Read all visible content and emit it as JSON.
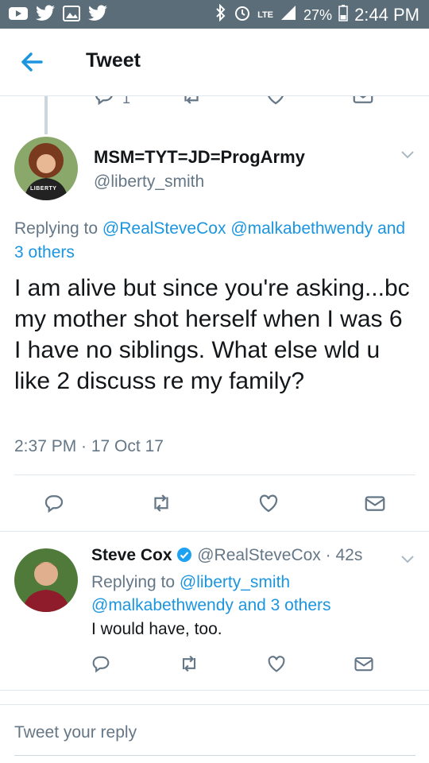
{
  "header": {
    "title": "Tweet"
  },
  "status_bar": {
    "network": "LTE",
    "battery": "27%",
    "time": "2:44 PM"
  },
  "main_tweet": {
    "display_name": "MSM=TYT=JD=ProgArmy",
    "handle": "@liberty_smith",
    "replying_prefix": "Replying to",
    "replying_to_1": "@RealSteveCox",
    "replying_to_2": "@malkabethwendy",
    "replying_others": "and 3 others",
    "text": "I am alive but since you're asking...bc my mother shot herself when I was 6 I have no siblings. What else wld u like 2 discuss re my family?",
    "timestamp": "2:37 PM · 17 Oct 17",
    "reply_count_above": "1",
    "avatar_badge": "LIBERTY"
  },
  "reply_tweet": {
    "display_name": "Steve Cox",
    "handle": "@RealSteveCox",
    "time": "· 42s",
    "replying_prefix": "Replying to",
    "replying_to_1": "@liberty_smith",
    "replying_to_2": "@malkabethwendy",
    "replying_others": "and 3 others",
    "text": "I would have, too."
  },
  "composer": {
    "placeholder": "Tweet your reply"
  },
  "colors": {
    "accent": "#1b95e0",
    "status_bar": "#5b6d78",
    "verified": "#1da1f2",
    "text_grey": "#657786"
  }
}
